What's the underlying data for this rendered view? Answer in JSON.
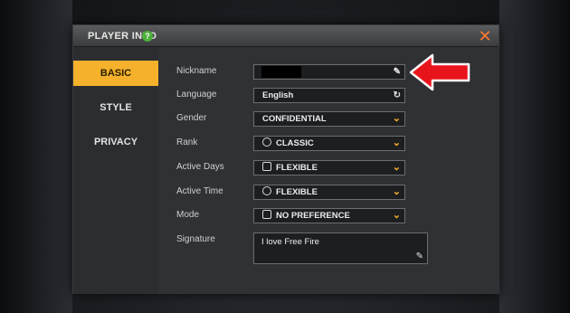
{
  "dialog": {
    "title": "PLAYER INFO",
    "help_label": "?",
    "close_label": "✕"
  },
  "tabs": [
    {
      "label": "BASIC",
      "active": true
    },
    {
      "label": "STYLE",
      "active": false
    },
    {
      "label": "PRIVACY",
      "active": false
    }
  ],
  "form": {
    "nickname": {
      "label": "Nickname",
      "value": "",
      "icon": "edit-icon"
    },
    "language": {
      "label": "Language",
      "value": "English",
      "icon": "refresh-icon"
    },
    "gender": {
      "label": "Gender",
      "value": "CONFIDENTIAL",
      "icon": "chevron-down-icon"
    },
    "rank": {
      "label": "Rank",
      "value": "CLASSIC",
      "icon": "chevron-down-icon"
    },
    "active_days": {
      "label": "Active Days",
      "value": "FLEXIBLE",
      "icon": "chevron-down-icon"
    },
    "active_time": {
      "label": "Active Time",
      "value": "FLEXIBLE",
      "icon": "chevron-down-icon"
    },
    "mode": {
      "label": "Mode",
      "value": "NO PREFERENCE",
      "icon": "chevron-down-icon"
    },
    "signature": {
      "label": "Signature",
      "value": "I love Free Fire",
      "icon": "edit-icon"
    }
  },
  "colors": {
    "accent": "#f5b12b",
    "close": "#ff7b2e",
    "help": "#4caf3a",
    "arrow": "#e8141c"
  }
}
